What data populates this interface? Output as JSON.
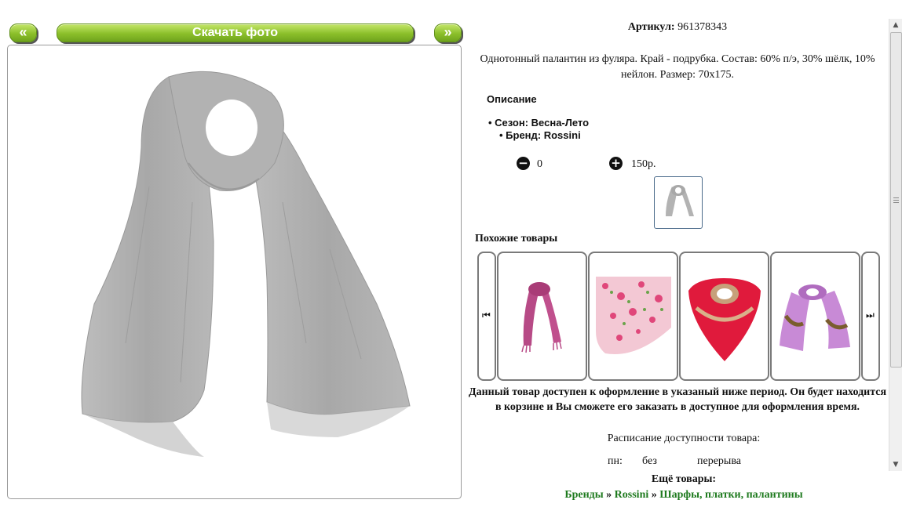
{
  "toolbar": {
    "prev_label": "«",
    "download_label": "Скачать фото",
    "next_label": "»"
  },
  "product": {
    "sku_label": "Артикул:",
    "sku_value": "961378343",
    "summary": "Однотонный палантин из фуляра. Край - подрубка. Состав: 60% п/э, 30% шёлк, 10% нейлон. Размер: 70х175.",
    "description_title": "Описание",
    "attributes": [
      "Сезон: Весна-Лето",
      "Бренд: Rossini"
    ],
    "quantity": "0",
    "price": "150р."
  },
  "similar": {
    "title": "Похожие товары",
    "items": [
      {
        "name": "pink-scarf"
      },
      {
        "name": "floral-shawl"
      },
      {
        "name": "red-paisley-shawl"
      },
      {
        "name": "lilac-paisley-scarf"
      }
    ]
  },
  "availability": {
    "notice": "Данный товар доступен к оформление в указаный ниже период. Он будет находится в корзине и Вы сможете его заказать в доступное для оформления время.",
    "schedule_title": "Расписание доступности товара:",
    "day": "пн:",
    "col2": "без",
    "col3": "перерыва"
  },
  "more": {
    "title": "Ещё товары:",
    "crumb1": "Бренды",
    "sep": "»",
    "crumb2": "Rossini",
    "crumb3": "Шарфы, платки, палантины"
  },
  "colors": {
    "accent_green": "#8bbf2a",
    "link_green": "#1e7a1e"
  }
}
